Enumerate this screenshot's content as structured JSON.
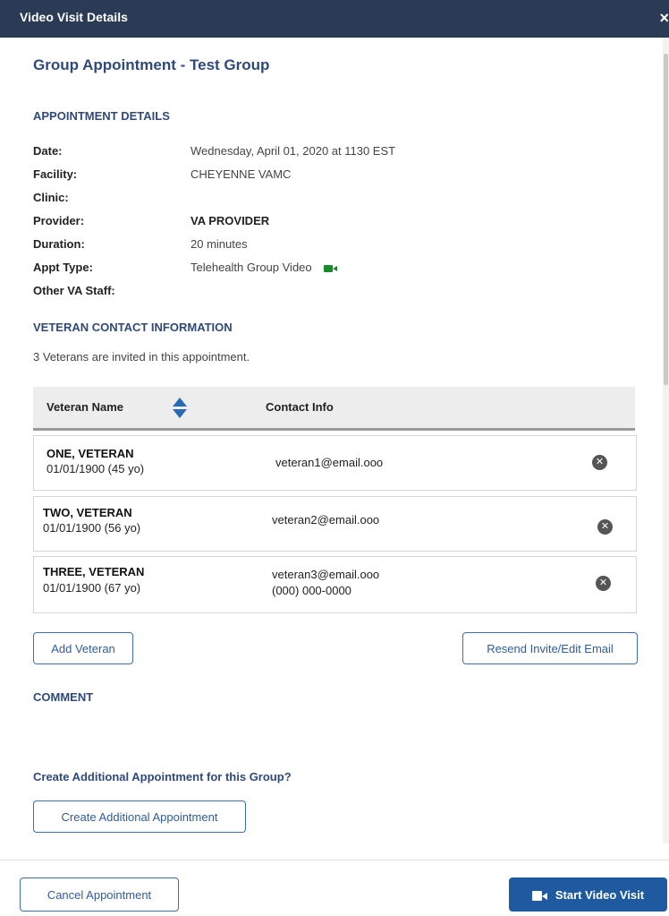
{
  "dialog": {
    "title": "Video Visit Details",
    "close_glyph": "×"
  },
  "header": {
    "title": "Group Appointment - Test Group"
  },
  "appointment_details": {
    "heading": "APPOINTMENT DETAILS",
    "rows": [
      {
        "label": "Date:",
        "value": "Wednesday, April 01, 2020 at 1130 EST"
      },
      {
        "label": "Facility:",
        "value": "CHEYENNE VAMC"
      },
      {
        "label": "Clinic:",
        "value": ""
      },
      {
        "label": "Provider:",
        "value": "VA PROVIDER"
      },
      {
        "label": "Duration:",
        "value": "20 minutes"
      },
      {
        "label": "Appt Type:",
        "value": "Telehealth Group Video",
        "icon": "video-camera-icon"
      },
      {
        "label": "Other VA Staff:",
        "value": ""
      }
    ]
  },
  "veteran_contact": {
    "heading": "VETERAN CONTACT INFORMATION",
    "note": "3 Veterans are invited in this appointment.",
    "columns": [
      "Veteran Name",
      "Contact Info"
    ],
    "rows": [
      {
        "name": "ONE, VETERAN",
        "dob": "01/01/1900 (45 yo)",
        "contact": [
          "veteran1@email.ooo"
        ]
      },
      {
        "name": "TWO, VETERAN",
        "dob": "01/01/1900 (56 yo)",
        "contact": [
          "veteran2@email.ooo"
        ]
      },
      {
        "name": "THREE, VETERAN",
        "dob": "01/01/1900 (67 yo)",
        "contact": [
          "veteran3@email.ooo",
          "(000) 000-0000"
        ]
      }
    ]
  },
  "actions": {
    "add_veteran": "Add Veteran",
    "resend_invite": "Resend Invite/Edit Email"
  },
  "comment": {
    "heading": "COMMENT"
  },
  "additional": {
    "question": "Create Additional Appointment for this Group?",
    "button": "Create Additional Appointment"
  },
  "footer": {
    "cancel": "Cancel Appointment",
    "start": "Start Video Visit"
  },
  "colors": {
    "titlebar": "#2b3a55",
    "accent": "#2f4a7a",
    "primary_button": "#1f5aa0",
    "camera_green": "#1a8a2a"
  }
}
